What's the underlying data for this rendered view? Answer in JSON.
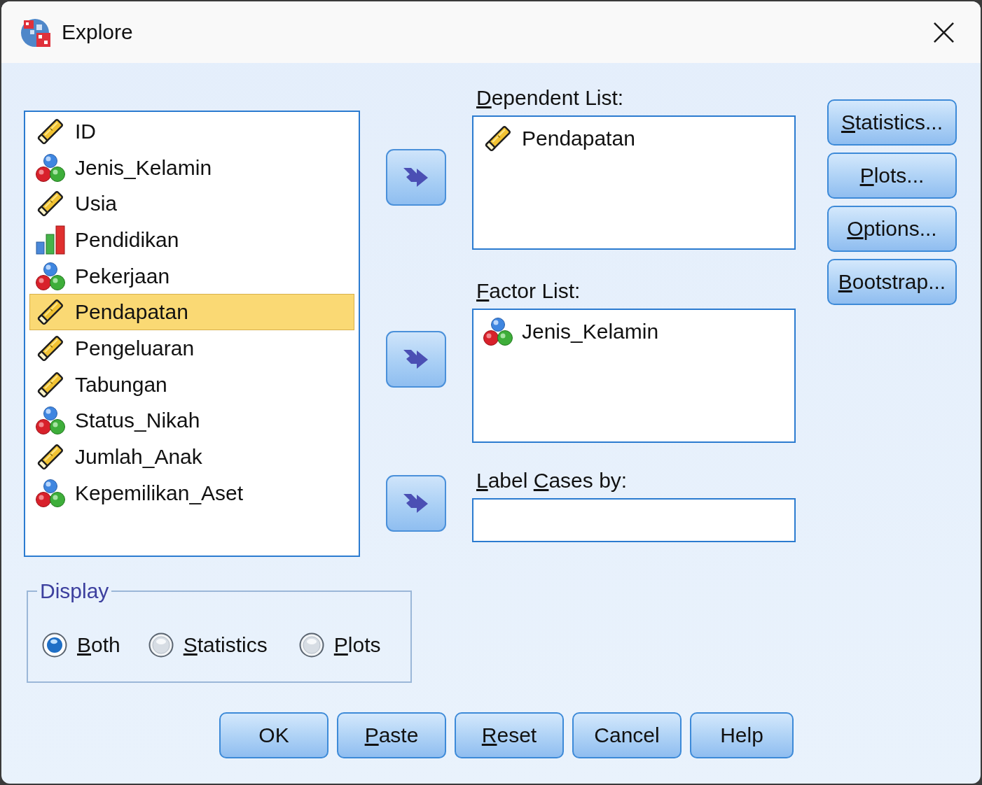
{
  "window": {
    "title": "Explore"
  },
  "variables": [
    {
      "name": "ID",
      "kind": "scale",
      "selected": false
    },
    {
      "name": "Jenis_Kelamin",
      "kind": "nominal",
      "selected": false
    },
    {
      "name": "Usia",
      "kind": "scale",
      "selected": false
    },
    {
      "name": "Pendidikan",
      "kind": "ordinal",
      "selected": false
    },
    {
      "name": "Pekerjaan",
      "kind": "nominal",
      "selected": false
    },
    {
      "name": "Pendapatan",
      "kind": "scale",
      "selected": true
    },
    {
      "name": "Pengeluaran",
      "kind": "scale",
      "selected": false
    },
    {
      "name": "Tabungan",
      "kind": "scale",
      "selected": false
    },
    {
      "name": "Status_Nikah",
      "kind": "nominal",
      "selected": false
    },
    {
      "name": "Jumlah_Anak",
      "kind": "scale",
      "selected": false
    },
    {
      "name": "Kepemilikan_Aset",
      "kind": "nominal",
      "selected": false
    }
  ],
  "targets": [
    {
      "label": "Dependent List:",
      "underlined_initials": [
        true,
        false
      ],
      "kind": "list",
      "items": [
        {
          "name": "Pendapatan",
          "kind": "scale"
        }
      ]
    },
    {
      "label": "Factor List:",
      "underlined_initials": [
        true,
        false
      ],
      "kind": "list",
      "items": [
        {
          "name": "Jenis_Kelamin",
          "kind": "nominal"
        }
      ]
    },
    {
      "label": "Label Cases by:",
      "underlined_initials": [
        true,
        true,
        false
      ],
      "kind": "field"
    }
  ],
  "side_buttons": [
    {
      "label": "Statistics...",
      "underlined_initials": [
        true
      ]
    },
    {
      "label": "Plots...",
      "underlined_initials": [
        true
      ]
    },
    {
      "label": "Options...",
      "underlined_initials": [
        true
      ]
    },
    {
      "label": "Bootstrap...",
      "underlined_initials": [
        true
      ]
    }
  ],
  "display": {
    "legend": "Display",
    "options": [
      {
        "label": "Both",
        "underlined_initials": [
          true
        ],
        "selected": true
      },
      {
        "label": "Statistics",
        "underlined_initials": [
          true
        ],
        "selected": false
      },
      {
        "label": "Plots",
        "underlined_initials": [
          true
        ],
        "selected": false
      }
    ]
  },
  "buttons": [
    {
      "label": "OK"
    },
    {
      "label": "Paste",
      "underlined_initials": [
        true
      ]
    },
    {
      "label": "Reset",
      "underlined_initials": [
        true
      ]
    },
    {
      "label": "Cancel"
    },
    {
      "label": "Help"
    }
  ]
}
